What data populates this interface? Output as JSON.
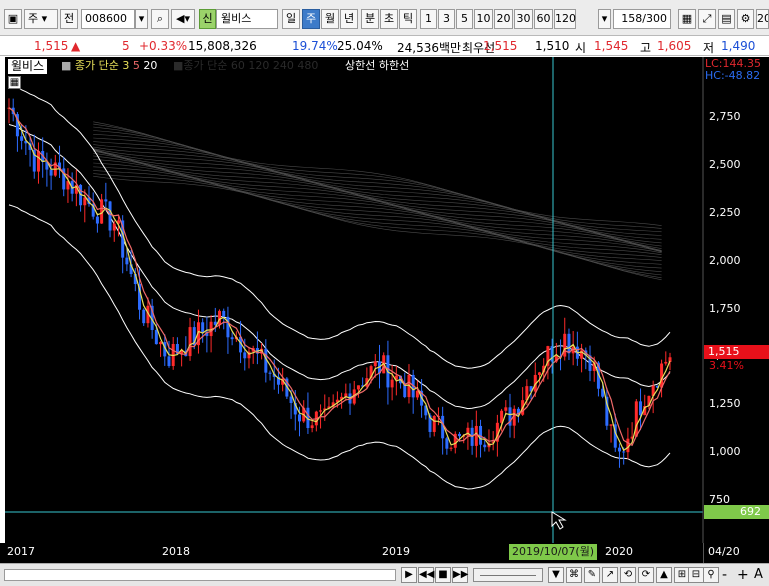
{
  "toolbar": {
    "market_type": "주",
    "period_btn": "전",
    "stock_code": "008600",
    "stock_badge": "신",
    "stock_name": "윌비스",
    "periods": [
      "일",
      "주",
      "월",
      "년"
    ],
    "intervals": [
      "분",
      "초",
      "틱"
    ],
    "numbers": [
      "1",
      "3",
      "5",
      "10",
      "20",
      "30",
      "60",
      "120"
    ],
    "count": "158/300",
    "clipped": "20"
  },
  "quote": {
    "price": "1,515",
    "change_arrow": "▲",
    "change": "5",
    "change_pct": "+0.33%",
    "volume": "15,808,326",
    "rate1": "19.74%",
    "rate2": "25.04%",
    "amount": "24,536백만",
    "best_label": "최우선",
    "best_ask": "1,515",
    "best_bid": "1,510",
    "open_label": "시",
    "open": "1,545",
    "high_label": "고",
    "high": "1,605",
    "low_label": "저",
    "low": "1,490"
  },
  "chart": {
    "legend_name": "윌비스",
    "ma_label": "종가 단순",
    "ma_periods": [
      "3",
      "5",
      "20"
    ],
    "legend_dim": "■종가 단순 60 120 240 480",
    "limit_labels": "상한선 하한선",
    "lc_label": "LC:144.35",
    "hc_label": "HC:-48.82",
    "y_ticks": [
      "2,750",
      "2,500",
      "2,250",
      "2,000",
      "1,750",
      "1,500",
      "1,250",
      "1,000",
      "750"
    ],
    "price_tag": "1,515",
    "price_tag_pct": "3.41%",
    "crosshair_value": "692",
    "x_ticks": [
      "2017",
      "2018",
      "2019",
      "2020"
    ],
    "crosshair_date": "2019/10/07(월)",
    "right_date": "04/20"
  },
  "chart_data": {
    "type": "candlestick",
    "title": "",
    "y_axis_ticks": [
      2750,
      2500,
      2250,
      2000,
      1750,
      1500,
      1250,
      1000,
      750
    ],
    "ylim": [
      600,
      3000
    ],
    "x_labels": [
      "2017",
      "2018",
      "2019",
      "2020"
    ],
    "crosshair": {
      "date": "2019/10/07(월)",
      "value": 692
    },
    "last_price": 1515,
    "approx_close_series": [
      2800,
      2520,
      2450,
      2300,
      2200,
      1750,
      1500,
      1600,
      1700,
      1550,
      1400,
      1200,
      1150,
      1350,
      1450,
      1350,
      1150,
      1050,
      1100,
      1200,
      1450,
      1600,
      1500,
      950,
      1300,
      1515
    ],
    "series_names": [
      "종가 단순 3",
      "종가 단순 5",
      "종가 단순 20"
    ]
  },
  "bottom": {
    "buttons": [
      "▶",
      "◀◀",
      "■",
      "▶▶",
      "▼",
      "+",
      "-",
      "+",
      "A"
    ]
  }
}
